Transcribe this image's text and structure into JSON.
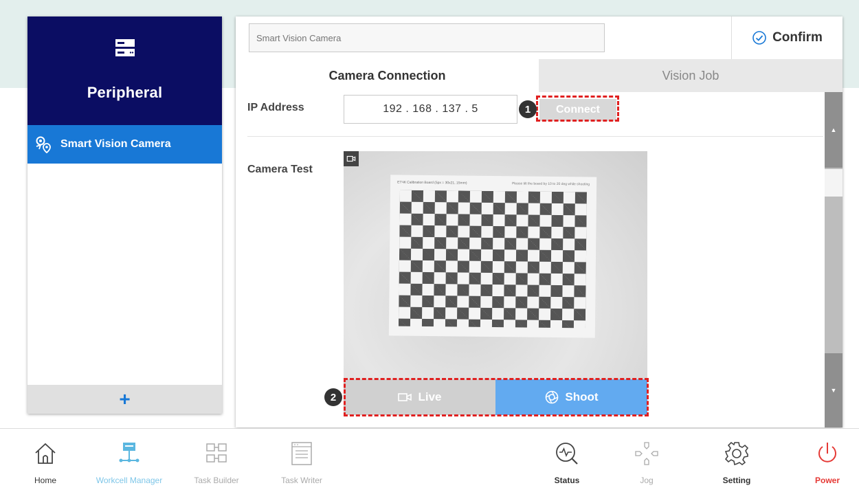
{
  "colors": {
    "primary_dark": "#0b0d63",
    "primary": "#1878d6",
    "shoot_button": "#62aaf0",
    "annotation": "#e02020",
    "power": "#e53935",
    "workcell_active": "#5bb7e0"
  },
  "sidebar": {
    "icon": "server-icon",
    "title": "Peripheral",
    "items": [
      {
        "label": "Smart Vision Camera",
        "icon": "camera-location-icon",
        "active": true
      }
    ],
    "add_label": "+"
  },
  "header": {
    "name_input": {
      "value": "Smart Vision Camera",
      "placeholder": "Smart Vision Camera"
    },
    "confirm_label": "Confirm"
  },
  "tabs": [
    {
      "label": "Camera Connection",
      "active": true
    },
    {
      "label": "Vision Job",
      "active": false
    }
  ],
  "connection": {
    "ip_label": "IP Address",
    "ip_value": "192  .  168  .  137  .    5",
    "connect_label": "Connect"
  },
  "camera_test": {
    "label": "Camera Test",
    "paper_header_left": "ЕТЧК Calibration Board (5px = 30x21, 15mm)",
    "paper_header_right": "Please tilt the board by 10 to 20 deg while shooting",
    "live_label": "Live",
    "shoot_label": "Shoot"
  },
  "annotations": {
    "badge_1": "1",
    "badge_2": "2"
  },
  "bottom_nav": [
    {
      "label": "Home",
      "icon": "home-icon",
      "state": "normal"
    },
    {
      "label": "Workcell Manager",
      "icon": "workcell-icon",
      "state": "active"
    },
    {
      "label": "Task Builder",
      "icon": "task-builder-icon",
      "state": "disabled"
    },
    {
      "label": "Task Writer",
      "icon": "task-writer-icon",
      "state": "disabled"
    },
    {
      "label": "Status",
      "icon": "status-icon",
      "state": "normal"
    },
    {
      "label": "Jog",
      "icon": "jog-icon",
      "state": "disabled"
    },
    {
      "label": "Setting",
      "icon": "gear-icon",
      "state": "normal"
    },
    {
      "label": "Power",
      "icon": "power-icon",
      "state": "alert"
    }
  ]
}
